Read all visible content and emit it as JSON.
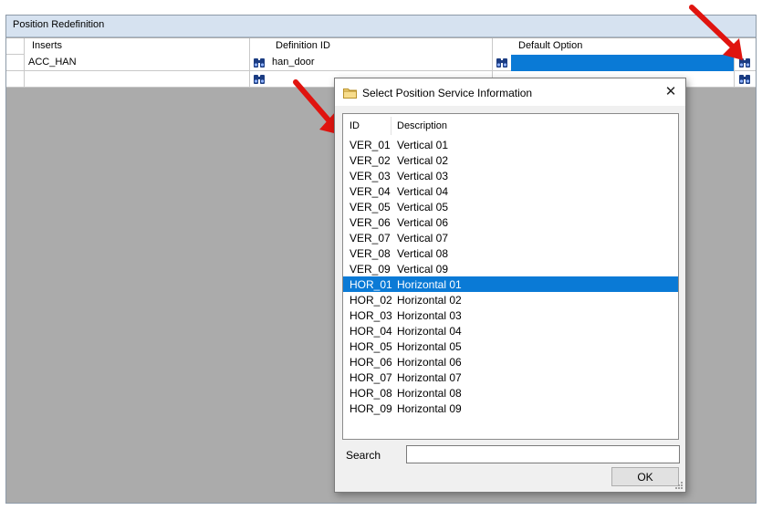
{
  "panel": {
    "title": "Position Redefinition"
  },
  "grid": {
    "columns": [
      "Inserts",
      "Definition ID",
      "Default Option"
    ],
    "rows": [
      {
        "insert": "ACC_HAN",
        "definition_id": "han_door",
        "default_option": ""
      },
      {
        "insert": "",
        "definition_id": "",
        "default_option": ""
      }
    ]
  },
  "dialog": {
    "title": "Select Position Service Information",
    "close_glyph": "✕",
    "list_headers": {
      "id": "ID",
      "description": "Description"
    },
    "items": [
      {
        "id": "VER_01",
        "description": "Vertical 01"
      },
      {
        "id": "VER_02",
        "description": "Vertical 02"
      },
      {
        "id": "VER_03",
        "description": "Vertical 03"
      },
      {
        "id": "VER_04",
        "description": "Vertical 04"
      },
      {
        "id": "VER_05",
        "description": "Vertical 05"
      },
      {
        "id": "VER_06",
        "description": "Vertical 06"
      },
      {
        "id": "VER_07",
        "description": "Vertical 07"
      },
      {
        "id": "VER_08",
        "description": "Vertical 08"
      },
      {
        "id": "VER_09",
        "description": "Vertical 09"
      },
      {
        "id": "HOR_01",
        "description": "Horizontal 01",
        "selected": true
      },
      {
        "id": "HOR_02",
        "description": "Horizontal 02"
      },
      {
        "id": "HOR_03",
        "description": "Horizontal 03"
      },
      {
        "id": "HOR_04",
        "description": "Horizontal 04"
      },
      {
        "id": "HOR_05",
        "description": "Horizontal 05"
      },
      {
        "id": "HOR_06",
        "description": "Horizontal 06"
      },
      {
        "id": "HOR_07",
        "description": "Horizontal 07"
      },
      {
        "id": "HOR_08",
        "description": "Horizontal 08"
      },
      {
        "id": "HOR_09",
        "description": "Horizontal 09"
      }
    ],
    "search_label": "Search",
    "search_value": "",
    "ok_label": "OK"
  },
  "colors": {
    "selection": "#0a7ad6",
    "panel_header": "#d6e2f0",
    "empty_area": "#ababab",
    "annotation_arrow": "#e0140f"
  },
  "icons": {
    "lookup": "binoculars-icon",
    "dialog": "folder-icon",
    "close": "close-icon",
    "annotation": "red-arrow-icon"
  }
}
